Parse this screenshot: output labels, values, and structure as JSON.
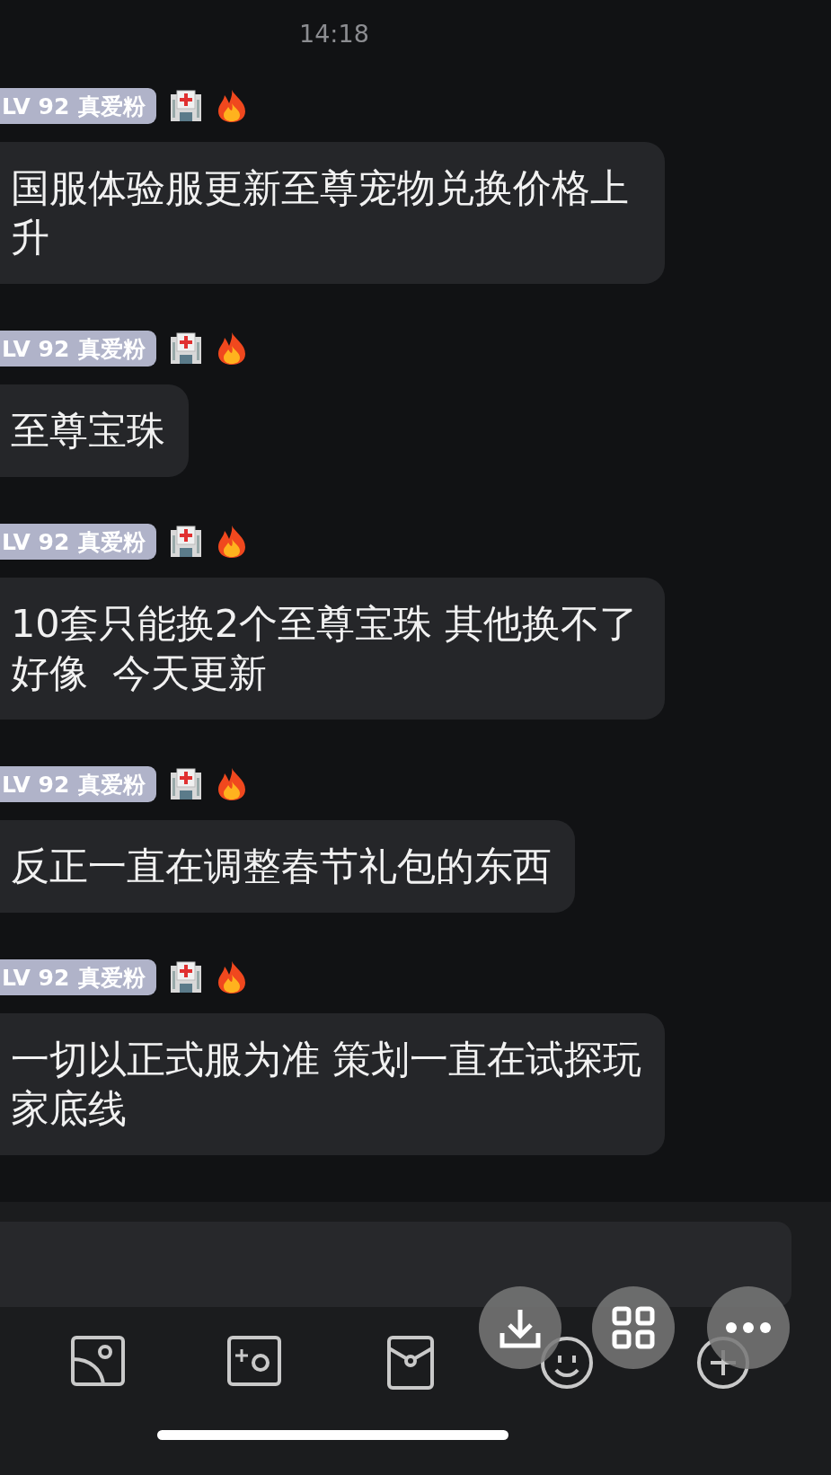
{
  "time": "14:18",
  "messages": [
    {
      "level": "LV 92",
      "title": "真爱粉",
      "text": "国服体验服更新至尊宠物兑换价格上升"
    },
    {
      "level": "LV 92",
      "title": "真爱粉",
      "text": "至尊宝珠"
    },
    {
      "level": "LV 92",
      "title": "真爱粉",
      "text": "10套只能换2个至尊宝珠 其他换不了好像  今天更新"
    },
    {
      "level": "LV 92",
      "title": "真爱粉",
      "text": "反正一直在调整春节礼包的东西"
    },
    {
      "level": "LV 92",
      "title": "真爱粉",
      "text": "一切以正式服为准 策划一直在试探玩家底线"
    }
  ]
}
